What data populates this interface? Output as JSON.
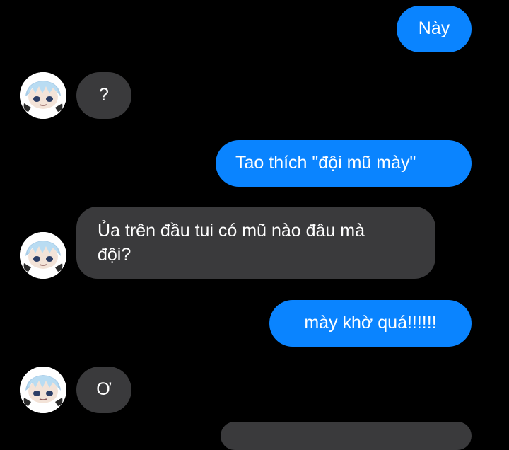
{
  "colors": {
    "background": "#000000",
    "outgoing_bubble": "#0a84ff",
    "incoming_bubble": "#3a3a3c",
    "text": "#ffffff"
  },
  "messages": [
    {
      "direction": "outgoing",
      "text": "Này"
    },
    {
      "direction": "incoming",
      "text": "?",
      "avatar": "chibi-character-avatar"
    },
    {
      "direction": "outgoing",
      "text": "Tao thích \"đội mũ mày\""
    },
    {
      "direction": "incoming",
      "text": "Ủa trên đầu tui có mũ nào đâu mà\nđội?",
      "avatar": "chibi-character-avatar"
    },
    {
      "direction": "outgoing",
      "text": "mày khờ quá!!!!!!"
    },
    {
      "direction": "incoming",
      "text": "Ơ",
      "avatar": "chibi-character-avatar"
    }
  ]
}
